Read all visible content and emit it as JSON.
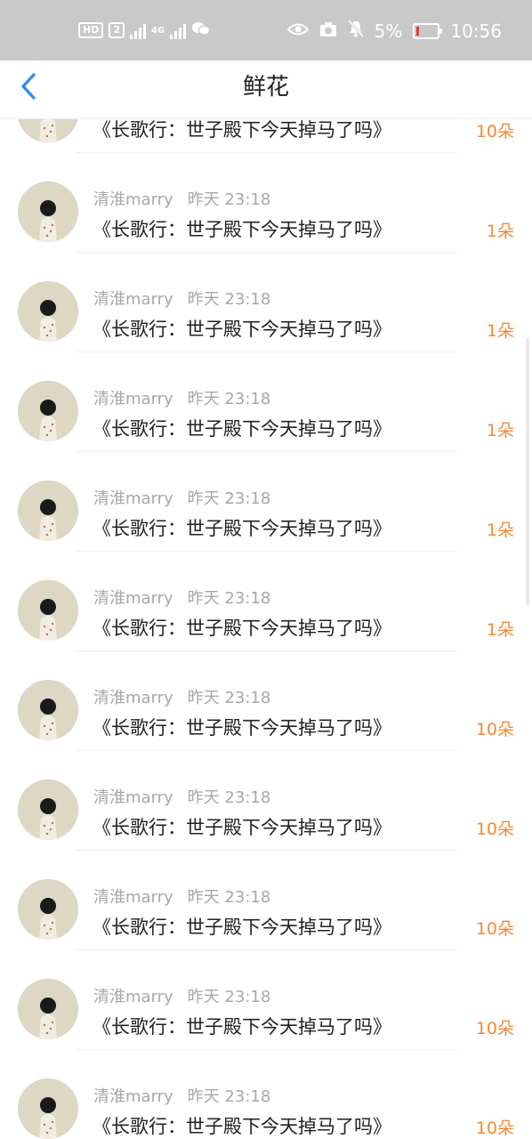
{
  "status_bar": {
    "left_chips": [
      "HD",
      "2"
    ],
    "network": "4G",
    "battery": "5%",
    "time": "10:56"
  },
  "header": {
    "title": "鲜花"
  },
  "colors": {
    "amount": "#f28a35",
    "meta": "#a7a7a7",
    "back": "#2d8cf0"
  },
  "rows": [
    {
      "book": "《长歌行：世子殿下今天掉马了吗》",
      "amount": "10朵"
    },
    {
      "user": "清淮marry",
      "time": "昨天 23:18",
      "book": "《长歌行：世子殿下今天掉马了吗》",
      "amount": "1朵"
    },
    {
      "user": "清淮marry",
      "time": "昨天 23:18",
      "book": "《长歌行：世子殿下今天掉马了吗》",
      "amount": "1朵"
    },
    {
      "user": "清淮marry",
      "time": "昨天 23:18",
      "book": "《长歌行：世子殿下今天掉马了吗》",
      "amount": "1朵"
    },
    {
      "user": "清淮marry",
      "time": "昨天 23:18",
      "book": "《长歌行：世子殿下今天掉马了吗》",
      "amount": "1朵"
    },
    {
      "user": "清淮marry",
      "time": "昨天 23:18",
      "book": "《长歌行：世子殿下今天掉马了吗》",
      "amount": "1朵"
    },
    {
      "user": "清淮marry",
      "time": "昨天 23:18",
      "book": "《长歌行：世子殿下今天掉马了吗》",
      "amount": "10朵"
    },
    {
      "user": "清淮marry",
      "time": "昨天 23:18",
      "book": "《长歌行：世子殿下今天掉马了吗》",
      "amount": "10朵"
    },
    {
      "user": "清淮marry",
      "time": "昨天 23:18",
      "book": "《长歌行：世子殿下今天掉马了吗》",
      "amount": "10朵"
    },
    {
      "user": "清淮marry",
      "time": "昨天 23:18",
      "book": "《长歌行：世子殿下今天掉马了吗》",
      "amount": "10朵"
    },
    {
      "user": "清淮marry",
      "time": "昨天 23:18",
      "book": "《长歌行：世子殿下今天掉马了吗》",
      "amount": "10朵"
    }
  ]
}
